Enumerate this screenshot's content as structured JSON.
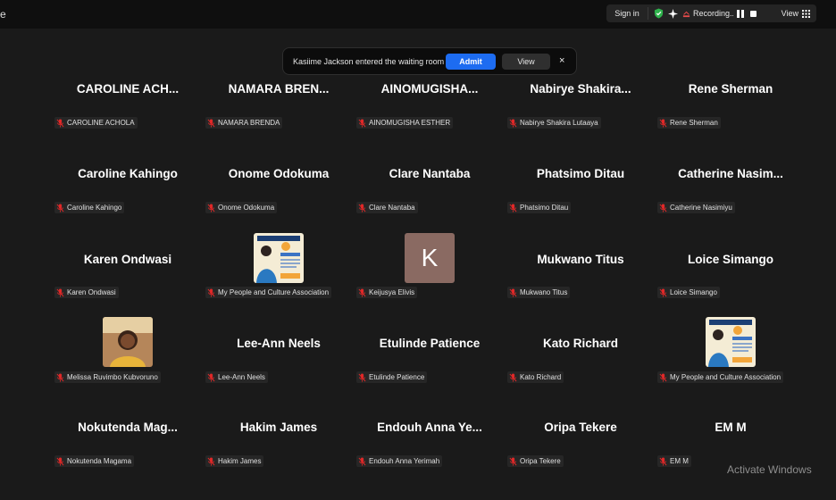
{
  "topbar": {
    "edge_glyph": "e",
    "signin_label": "Sign in",
    "recording_label": "Recording...",
    "view_label": "View"
  },
  "notification": {
    "message": "Kasiime Jackson entered the waiting room",
    "admit_label": "Admit",
    "view_label": "View",
    "close_label": "×"
  },
  "colors": {
    "background": "#1a1a1a",
    "admit_blue": "#1d6cf1",
    "muted_mic_red": "#e02828",
    "shield_green": "#2fb24c",
    "recording_red": "#e74b4b"
  },
  "participants": [
    {
      "display": "CAROLINE ACH...",
      "tag": "CAROLINE ACHOLA"
    },
    {
      "display": "NAMARA BREN...",
      "tag": "NAMARA BRENDA"
    },
    {
      "display": "AINOMUGISHA...",
      "tag": "AINOMUGISHA ESTHER"
    },
    {
      "display": "Nabirye Shakira...",
      "tag": "Nabirye Shakira Lutaaya"
    },
    {
      "display": "Rene Sherman",
      "tag": "Rene Sherman"
    },
    {
      "display": "Caroline Kahingo",
      "tag": "Caroline Kahingo"
    },
    {
      "display": "Onome Odokuma",
      "tag": "Onome Odokuma"
    },
    {
      "display": "Clare Nantaba",
      "tag": "Clare Nantaba"
    },
    {
      "display": "Phatsimo Ditau",
      "tag": "Phatsimo Ditau"
    },
    {
      "display": "Catherine Nasim...",
      "tag": "Catherine Nasimiyu"
    },
    {
      "display": "Karen Ondwasi",
      "tag": "Karen Ondwasi"
    },
    {
      "display": "",
      "tag": "My People and Culture Association",
      "picture": "poster"
    },
    {
      "display": "",
      "tag": "Keijusya Elivis",
      "picture": "letter",
      "letter": "K"
    },
    {
      "display": "Mukwano Titus",
      "tag": "Mukwano Titus"
    },
    {
      "display": "Loice Simango",
      "tag": "Loice Simango"
    },
    {
      "display": "",
      "tag": "Melissa Ruvimbo Kubvoruno",
      "picture": "photo"
    },
    {
      "display": "Lee-Ann Neels",
      "tag": "Lee-Ann Neels"
    },
    {
      "display": "Etulinde Patience",
      "tag": "Etulinde Patience"
    },
    {
      "display": "Kato Richard",
      "tag": "Kato Richard"
    },
    {
      "display": "",
      "tag": "My People and Culture Association",
      "picture": "poster"
    },
    {
      "display": "Nokutenda Mag...",
      "tag": "Nokutenda Magama"
    },
    {
      "display": "Hakim James",
      "tag": "Hakim James"
    },
    {
      "display": "Endouh Anna Ye...",
      "tag": "Endouh Anna Yerimah"
    },
    {
      "display": "Oripa Tekere",
      "tag": "Oripa Tekere"
    },
    {
      "display": "EM M",
      "tag": "EM M"
    }
  ],
  "watermark": "Activate Windows"
}
